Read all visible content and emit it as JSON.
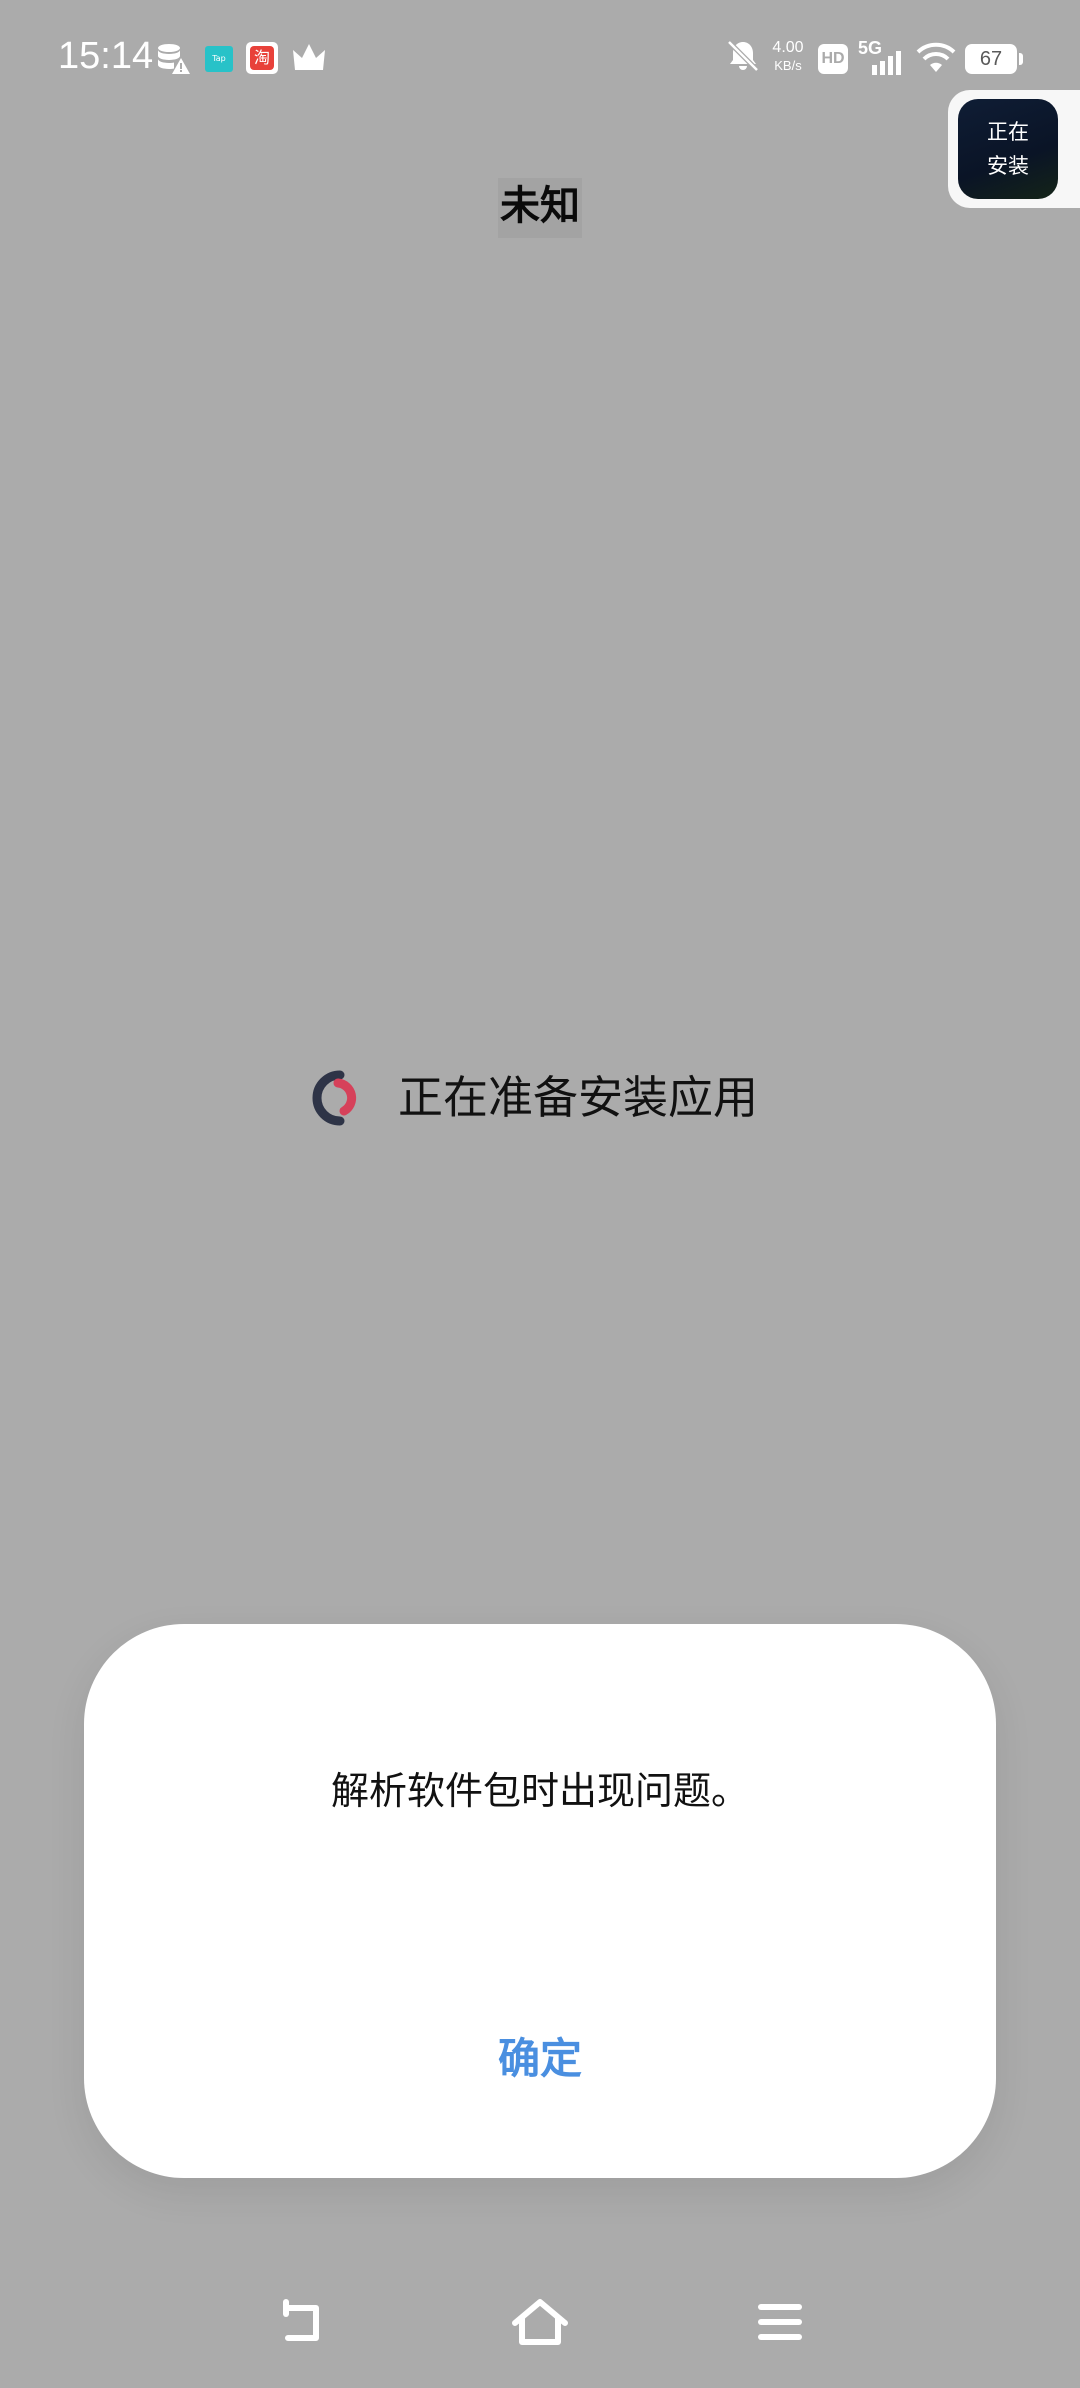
{
  "status_bar": {
    "time": "15:14",
    "network_speed_value": "4.00",
    "network_speed_unit": "KB/s",
    "hd_label": "HD",
    "network_type": "5G",
    "battery": "67",
    "icons": [
      "database-warning-icon",
      "taptap-app-icon",
      "taobao-app-icon",
      "crown-icon",
      "bell-off-icon",
      "signal-icon",
      "wifi-icon",
      "battery-icon"
    ]
  },
  "floating_bubble": {
    "line1": "正在",
    "line2": "安装"
  },
  "header": {
    "title": "未知"
  },
  "loading": {
    "text": "正在准备安装应用",
    "spinner_colors": [
      "#2e3447",
      "#d6415a"
    ]
  },
  "dialog": {
    "message": "解析软件包时出现问题。",
    "confirm_label": "确定",
    "accent_color": "#4a8fe0"
  },
  "nav_bar": {
    "icons": [
      "back-icon",
      "home-icon",
      "menu-icon"
    ]
  }
}
